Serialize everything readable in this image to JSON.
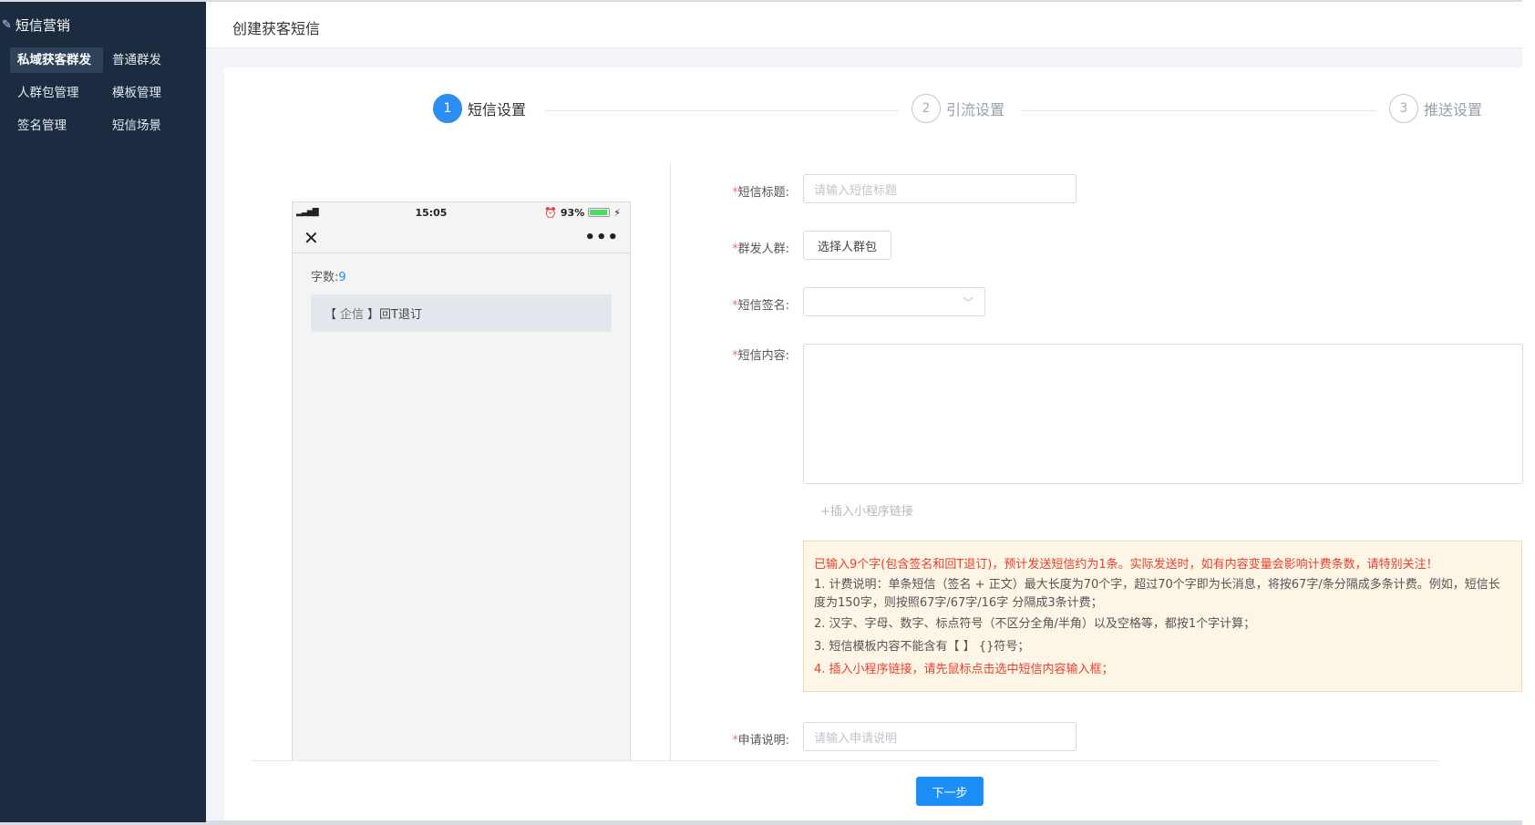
{
  "sidebar": {
    "title": "短信营销",
    "items": [
      {
        "label": "私域获客群发"
      },
      {
        "label": "普通群发"
      },
      {
        "label": "人群包管理"
      },
      {
        "label": "模板管理"
      },
      {
        "label": "签名管理"
      },
      {
        "label": "短信场景"
      }
    ]
  },
  "header": {
    "title": "创建获客短信"
  },
  "steps": [
    {
      "number": "1",
      "label": "短信设置",
      "active": true
    },
    {
      "number": "2",
      "label": "引流设置",
      "active": false
    },
    {
      "number": "3",
      "label": "推送设置",
      "active": false
    }
  ],
  "phone": {
    "time": "15:05",
    "battery": "93%",
    "battery_level": 0.93,
    "char_count_label": "字数:",
    "char_count": "9",
    "message_open": "【",
    "message_sign": "企信",
    "message_close": "】回T退订"
  },
  "form": {
    "title_label": "短信标题:",
    "title_placeholder": "请输入短信标题",
    "crowd_label": "群发人群:",
    "crowd_button": "选择人群包",
    "sign_label": "短信签名:",
    "content_label": "短信内容:",
    "insert_link": "+插入小程序链接",
    "apply_label": "申请说明:",
    "apply_placeholder": "请输入申请说明",
    "required_mark": "*"
  },
  "notice": {
    "headline": "已输入9个字(包含签名和回T退订)，预计发送短信约为1条。实际发送时，如有内容变量会影响计费条数，请特别关注！",
    "rule1": "1. 计费说明：单条短信（签名 + 正文）最大长度为70个字，超过70个字即为长消息，将按67字/条分隔成多条计费。例如，短信长度为150字，则按照67字/67字/16字 分隔成3条计费；",
    "rule2": "2. 汉字、字母、数字、标点符号（不区分全角/半角）以及空格等，都按1个字计算；",
    "rule3": "3. 短信模板内容不能含有【 】 {}符号；",
    "rule4": "4. 插入小程序链接，请先鼠标点击选中短信内容输入框；"
  },
  "footer": {
    "next_button": "下一步"
  },
  "colors": {
    "primary": "#1b8ef8",
    "sidebar_bg": "#1b2c40",
    "warning_bg": "#fdf6e7",
    "danger": "#e8402f"
  }
}
